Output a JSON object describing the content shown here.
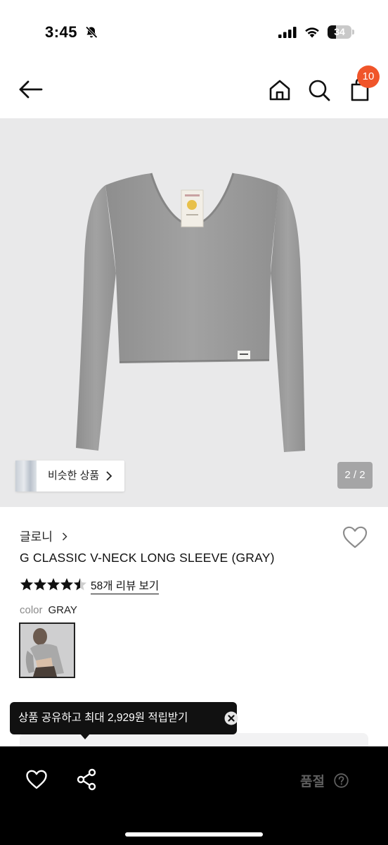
{
  "status_bar": {
    "time": "3:45",
    "battery": "34",
    "battery_level": 0.34,
    "icons": [
      "bell-muted-icon",
      "signal-icon",
      "wifi-icon",
      "battery-icon"
    ]
  },
  "nav": {
    "icons": [
      "back-arrow-icon",
      "home-icon",
      "search-icon",
      "shopping-bag-icon"
    ],
    "cart_count": "10",
    "badge_color": "#f0552a"
  },
  "gallery": {
    "similar_label": "비슷한 상품",
    "page_indicator": "2 / 2",
    "background": "#e9e9ea",
    "garment_color": "#9c9c9c"
  },
  "product": {
    "brand": "글로니",
    "name": "G CLASSIC V-NECK LONG SLEEVE (GRAY)",
    "rating": 4.5,
    "review_link": "58개 리뷰 보기",
    "color_label": "color",
    "color_value": "GRAY"
  },
  "tooltip": {
    "text": "상품 공유하고 최대 2,929원 적립받기"
  },
  "bottom_bar": {
    "soldout_label": "품절",
    "icons": [
      "heart-icon",
      "share-icon",
      "help-icon"
    ],
    "background": "#000000"
  }
}
